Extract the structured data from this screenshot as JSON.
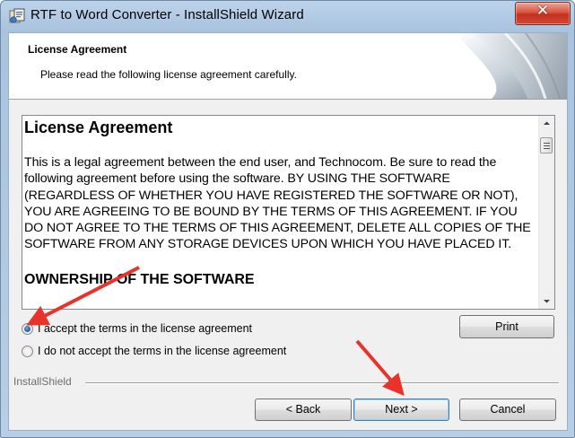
{
  "window": {
    "title": "RTF to Word Converter - InstallShield Wizard",
    "close_glyph": "✕",
    "icon": "installer-icon"
  },
  "header": {
    "title": "License Agreement",
    "subtitle": "Please read the following license agreement carefully."
  },
  "license": {
    "heading": "License Agreement",
    "paragraph": "This is a legal agreement between the end user, and Technocom.  Be sure to read the following agreement before using the software.  BY USING THE SOFTWARE (REGARDLESS OF WHETHER YOU HAVE REGISTERED THE SOFTWARE OR NOT), YOU ARE AGREEING TO BE BOUND BY THE TERMS OF THIS AGREEMENT.  IF YOU DO NOT AGREE TO THE TERMS OF THIS AGREEMENT, DELETE ALL COPIES OF THE SOFTWARE FROM ANY STORAGE DEVICES UPON WHICH YOU HAVE PLACED IT.",
    "subheading": "OWNERSHIP OF THE SOFTWARE"
  },
  "options": {
    "accept_label": "I accept the terms in the license agreement",
    "decline_label": "I do not accept the terms in the license agreement",
    "selected": "accept"
  },
  "buttons": {
    "print": "Print",
    "back": "< Back",
    "next": "Next >",
    "cancel": "Cancel"
  },
  "footer": {
    "brand": "InstallShield"
  },
  "colors": {
    "annotation_arrow": "#e8322a"
  }
}
